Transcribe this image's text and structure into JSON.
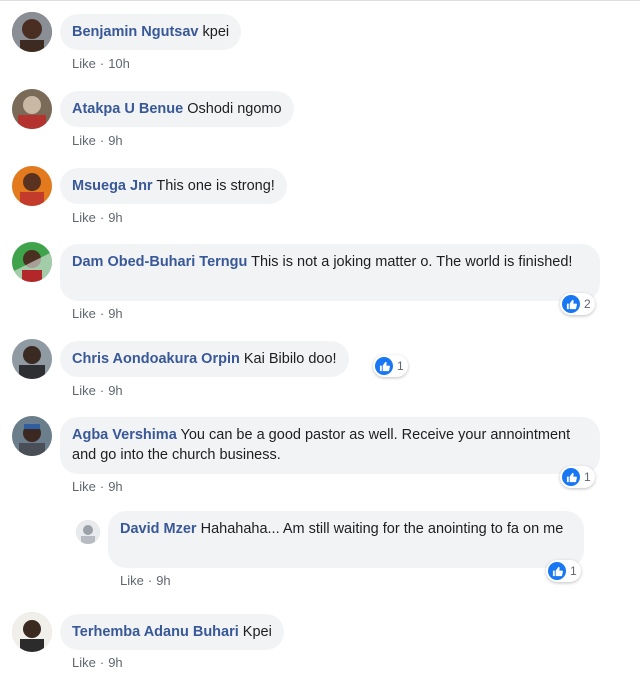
{
  "comments": [
    {
      "author": "Benjamin Ngutsav",
      "text": " kpei",
      "like": "Like",
      "time": "10h"
    },
    {
      "author": "Atakpa U Benue",
      "text": " Oshodi ngomo",
      "like": "Like",
      "time": "9h"
    },
    {
      "author": "Msuega Jnr",
      "text": " This one is strong!",
      "like": "Like",
      "time": "9h"
    },
    {
      "author": "Dam Obed-Buhari Terngu",
      "text": " This is not a joking matter o. The world is finished!",
      "like": "Like",
      "time": "9h",
      "reactions": "2"
    },
    {
      "author": "Chris Aondoakura Orpin",
      "text": " Kai Bibilo doo!",
      "like": "Like",
      "time": "9h",
      "reactions": "1"
    },
    {
      "author": "Agba Vershima",
      "text": " You can be a good pastor as well. Receive your annointment and go into the church business.",
      "like": "Like",
      "time": "9h",
      "reactions": "1"
    },
    {
      "author": "David Mzer",
      "text": " Hahahaha... Am still waiting for the anointing to fa on me",
      "like": "Like",
      "time": "9h",
      "reactions": "1"
    },
    {
      "author": "Terhemba Adanu Buhari",
      "text": " Kpei",
      "like": "Like",
      "time": "9h"
    }
  ],
  "colors": {
    "author": "#385898",
    "bubble": "#f2f3f5",
    "meta": "#616770",
    "like_blue": "#1877f2"
  },
  "icons": {
    "reaction": "thumbs-up-icon"
  }
}
